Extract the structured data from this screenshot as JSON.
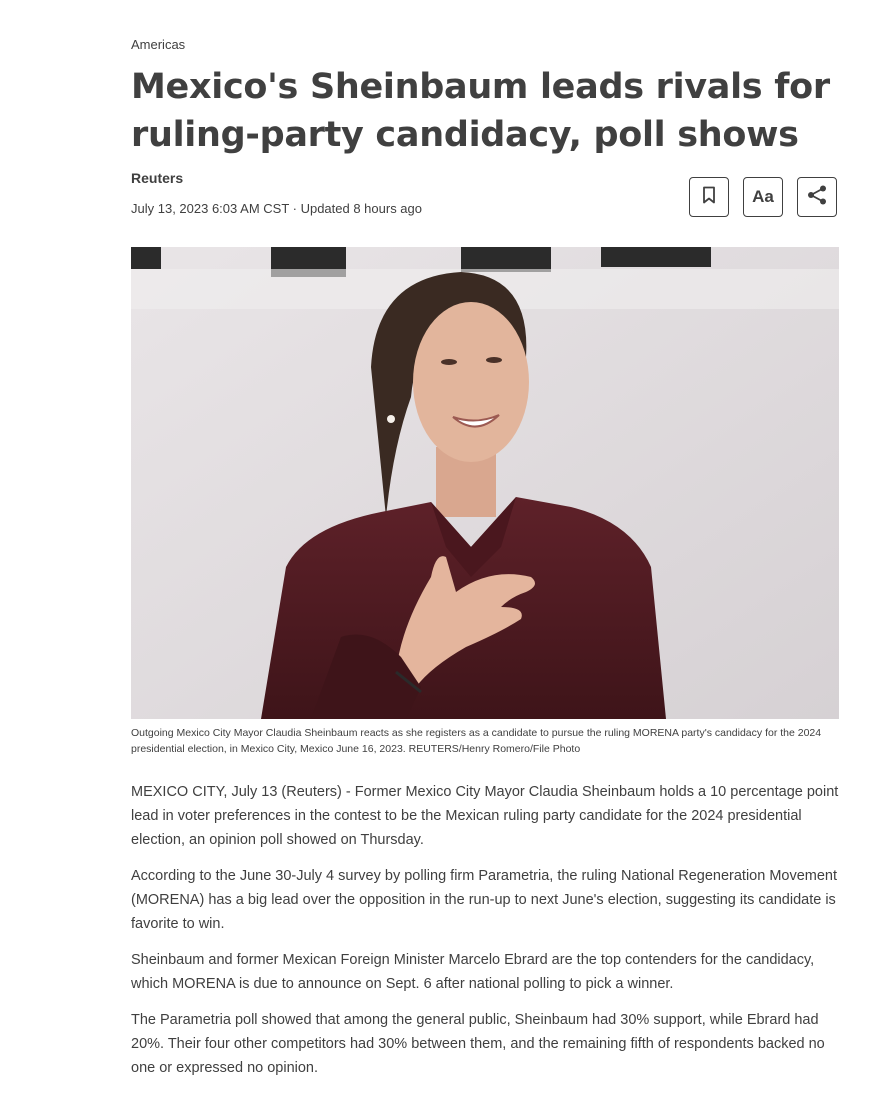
{
  "article": {
    "section": "Americas",
    "headline": "Mexico's Sheinbaum leads rivals for ruling-party candidacy, poll shows",
    "byline": "Reuters",
    "dateline": "July 13, 2023 6:03 AM CST · Updated 8 hours ago",
    "tools": {
      "bookmark_icon": "bookmark-icon",
      "text_size_label": "Aa",
      "share_icon": "share-icon"
    },
    "photo": {
      "alt": "Claudia Sheinbaum smiling with hand on chest",
      "backdrop_color": "#e8e4e6",
      "jacket_color": "#5a1e26"
    },
    "caption": "Outgoing Mexico City Mayor Claudia Sheinbaum reacts as she registers as a candidate to pursue the ruling MORENA party's candidacy for the 2024 presidential election, in Mexico City, Mexico June 16, 2023. REUTERS/Henry Romero/File Photo",
    "paragraphs": [
      "MEXICO CITY, July 13 (Reuters) - Former Mexico City Mayor Claudia Sheinbaum holds a 10 percentage point lead in voter preferences in the contest to be the Mexican ruling party candidate for the 2024 presidential election, an opinion poll showed on Thursday.",
      "According to the June 30-July 4 survey by polling firm Parametria, the ruling National Regeneration Movement (MORENA) has a big lead over the opposition in the run-up to next June's election, suggesting its candidate is favorite to win.",
      "Sheinbaum and former Mexican Foreign Minister Marcelo Ebrard are the top contenders for the candidacy, which MORENA is due to announce on Sept. 6 after national polling to pick a winner.",
      "The Parametria poll showed that among the general public, Sheinbaum had 30% support, while Ebrard had 20%. Their four other competitors had 30% between them, and the remaining fifth of respondents backed no one or expressed no opinion."
    ]
  }
}
